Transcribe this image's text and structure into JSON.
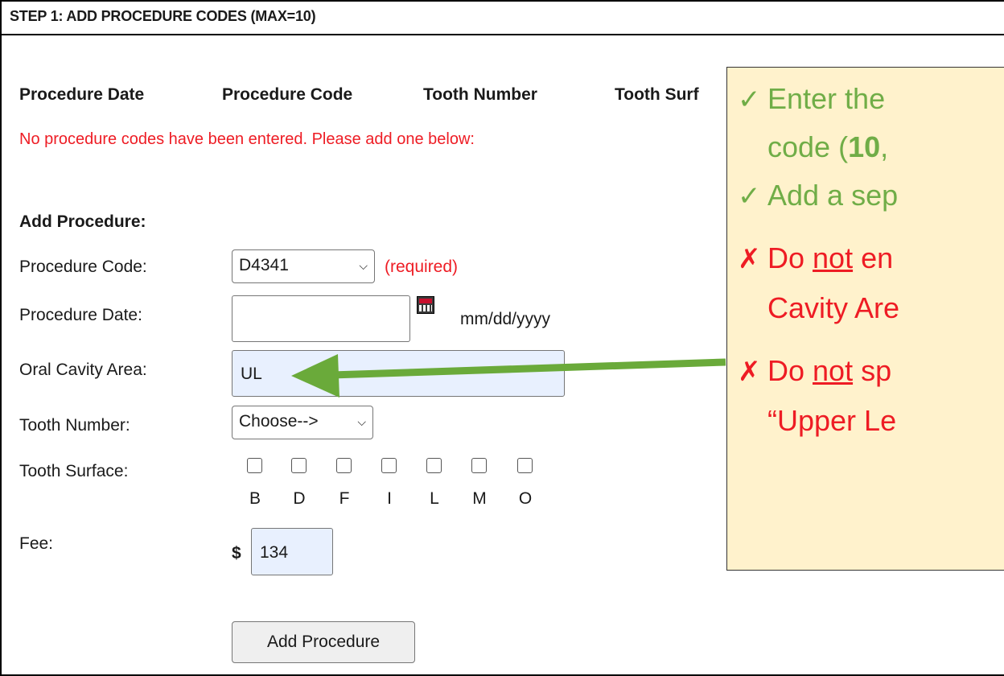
{
  "header": {
    "title": "STEP 1: ADD PROCEDURE CODES (MAX=10)"
  },
  "table_headers": [
    "Procedure Date",
    "Procedure Code",
    "Tooth Number",
    "Tooth Surf"
  ],
  "notice": "No procedure codes have been entered. Please add one below:",
  "form": {
    "section_label": "Add Procedure:",
    "procedure_code": {
      "label": "Procedure Code:",
      "value": "D4341",
      "required_text": "(required)"
    },
    "procedure_date": {
      "label": "Procedure Date:",
      "value": "",
      "format_hint": "mm/dd/yyyy"
    },
    "oral_cavity_area": {
      "label": "Oral Cavity Area:",
      "value": "UL"
    },
    "tooth_number": {
      "label": "Tooth Number:",
      "value": "Choose-->"
    },
    "tooth_surface": {
      "label": "Tooth Surface:",
      "options": [
        "B",
        "D",
        "F",
        "I",
        "L",
        "M",
        "O"
      ]
    },
    "fee": {
      "label": "Fee:",
      "currency": "$",
      "value": "134"
    },
    "submit_label": "Add Procedure"
  },
  "callout": {
    "line1": "Enter the",
    "line2_pre": "code (",
    "line2_bold": "10",
    "line2_post": ",",
    "line3": "Add a sep",
    "line4_pre": "Do ",
    "line4_u": "not",
    "line4_post": " en",
    "line5": "Cavity Are",
    "line6_pre": "Do ",
    "line6_u": "not",
    "line6_post": " sp",
    "line7": "“Upper Le",
    "check_icon": "✓",
    "cross_icon": "✗",
    "colors": {
      "background": "#fff2cc",
      "positive": "#70ad47",
      "negative": "#ee1c24",
      "arrow": "#6aaa3a"
    }
  }
}
